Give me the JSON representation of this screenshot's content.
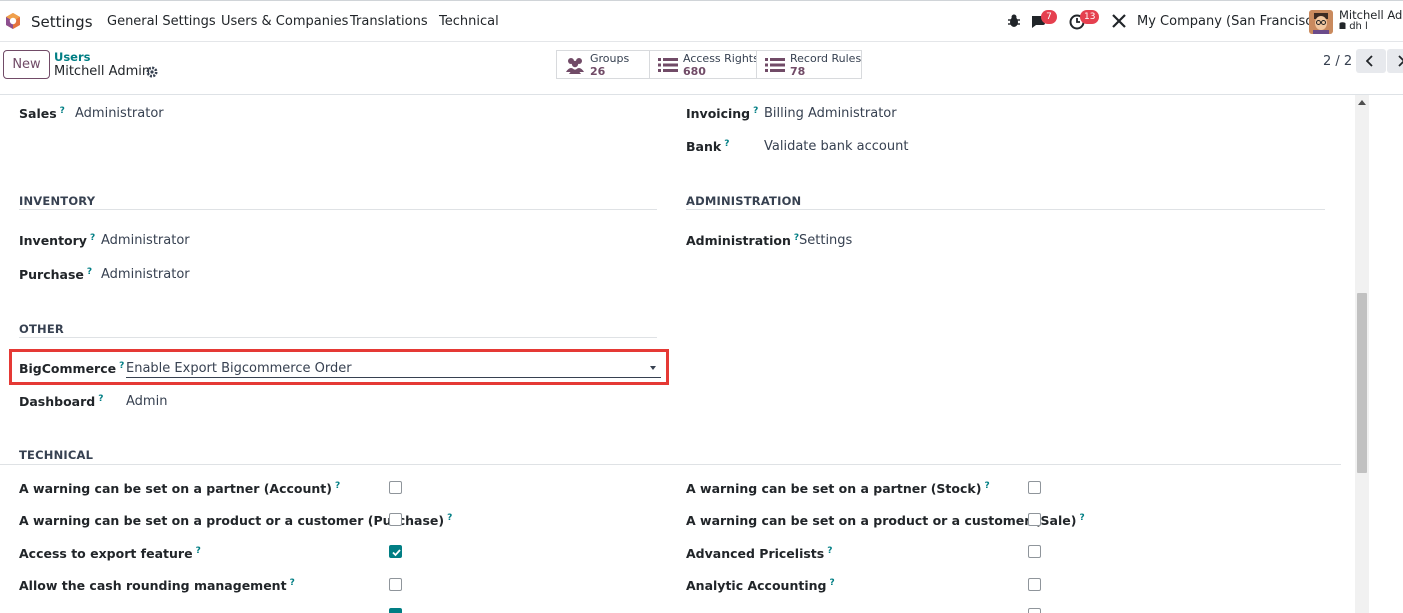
{
  "navbar": {
    "app_name": "Settings",
    "menu": [
      "General Settings",
      "Users & Companies",
      "Translations",
      "Technical"
    ],
    "messages_count": "7",
    "activities_count": "13",
    "company": "My Company (San Francisco)",
    "user_name": "Mitchell Adm",
    "user_db": "dh l"
  },
  "control": {
    "new_label": "New",
    "breadcrumb_parent": "Users",
    "breadcrumb_current": "Mitchell Admin",
    "stats": [
      {
        "label": "Groups",
        "value": "26"
      },
      {
        "label": "Access Rights",
        "value": "680"
      },
      {
        "label": "Record Rules",
        "value": "78"
      }
    ],
    "pager": "2 / 2"
  },
  "form": {
    "sales": {
      "label": "Sales",
      "value": "Administrator"
    },
    "invoicing": {
      "label": "Invoicing",
      "value": "Billing Administrator"
    },
    "bank": {
      "label": "Bank",
      "value": "Validate bank account"
    },
    "inventory_section": "INVENTORY",
    "administration_section": "ADMINISTRATION",
    "inventory": {
      "label": "Inventory",
      "value": "Administrator"
    },
    "purchase": {
      "label": "Purchase",
      "value": "Administrator"
    },
    "administration": {
      "label": "Administration",
      "value": "Settings"
    },
    "other_section": "OTHER",
    "bigcommerce": {
      "label": "BigCommerce",
      "value": "Enable Export Bigcommerce Order"
    },
    "dashboard": {
      "label": "Dashboard",
      "value": "Admin"
    },
    "technical_section": "TECHNICAL",
    "tech_left": [
      {
        "label": "A warning can be set on a partner (Account)",
        "checked": false
      },
      {
        "label": "A warning can be set on a product or a customer (Purchase)",
        "checked": false
      },
      {
        "label": "Access to export feature",
        "checked": true
      },
      {
        "label": "Allow the cash rounding management",
        "checked": false
      }
    ],
    "tech_right": [
      {
        "label": "A warning can be set on a partner (Stock)",
        "checked": false
      },
      {
        "label": "A warning can be set on a product or a customer (Sale)",
        "checked": false
      },
      {
        "label": "Advanced Pricelists",
        "checked": false
      },
      {
        "label": "Analytic Accounting",
        "checked": false
      }
    ],
    "help_mark": "?"
  },
  "colors": {
    "brand": "#714b67",
    "accent": "#017e84",
    "badge": "#e5404f",
    "highlight": "#e53935"
  }
}
